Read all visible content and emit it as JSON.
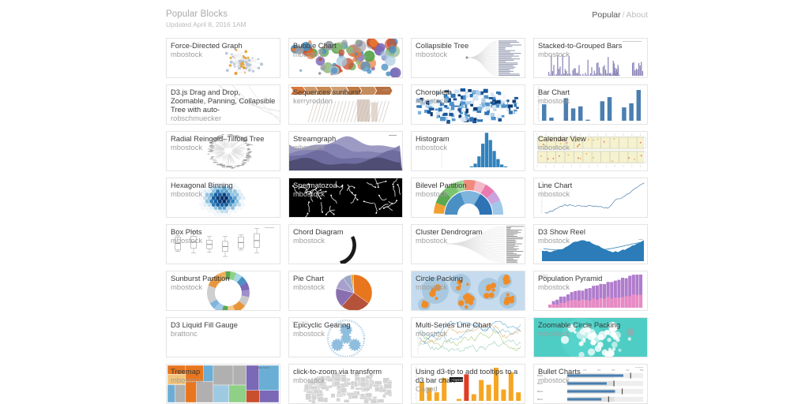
{
  "header": {
    "title": "Popular Blocks",
    "subtitle": "Updated April 8, 2016 1AM",
    "nav": {
      "current": "Popular",
      "separator": "/",
      "other": "About"
    }
  },
  "grid": {
    "cards": [
      {
        "title": "Force-Directed Graph",
        "author": "mbostock",
        "thumb": "force-directed-graph"
      },
      {
        "title": "Bubble Chart",
        "author": "mbostock",
        "thumb": "bubble-chart"
      },
      {
        "title": "Collapsible Tree",
        "author": "mbostock",
        "thumb": "collapsible-tree"
      },
      {
        "title": "Stacked-to-Grouped Bars",
        "author": "mbostock",
        "thumb": "stacked-to-grouped-bars"
      },
      {
        "title": "D3.js Drag and Drop, Zoomable, Panning, Collapsible Tree with auto-",
        "author": "robschmuecker",
        "thumb": "drag-drop-tree"
      },
      {
        "title": "Sequences sunburst",
        "author": "kerryrodden",
        "thumb": "sequences-sunburst"
      },
      {
        "title": "Choropleth",
        "author": "mbostock",
        "thumb": "choropleth"
      },
      {
        "title": "Bar Chart",
        "author": "mbostock",
        "thumb": "bar-chart"
      },
      {
        "title": "Radial Reingold–Tilford Tree",
        "author": "mbostock",
        "thumb": "radial-tidy-tree"
      },
      {
        "title": "Streamgraph",
        "author": "mbostock",
        "thumb": "streamgraph"
      },
      {
        "title": "Histogram",
        "author": "mbostock",
        "thumb": "histogram"
      },
      {
        "title": "Calendar View",
        "author": "mbostock",
        "thumb": "calendar-view"
      },
      {
        "title": "Hexagonal Binning",
        "author": "mbostock",
        "thumb": "hexagonal-binning"
      },
      {
        "title": "Spermatozoa",
        "author": "mbostock",
        "thumb": "spermatozoa"
      },
      {
        "title": "Bilevel Partition",
        "author": "mbostock",
        "thumb": "bilevel-partition"
      },
      {
        "title": "Line Chart",
        "author": "mbostock",
        "thumb": "line-chart"
      },
      {
        "title": "Box Plots",
        "author": "mbostock",
        "thumb": "box-plots"
      },
      {
        "title": "Chord Diagram",
        "author": "mbostock",
        "thumb": "chord-diagram"
      },
      {
        "title": "Cluster Dendrogram",
        "author": "mbostock",
        "thumb": "cluster-dendrogram"
      },
      {
        "title": "D3 Show Reel",
        "author": "mbostock",
        "thumb": "d3-show-reel"
      },
      {
        "title": "Sunburst Partition",
        "author": "mbostock",
        "thumb": "sunburst-partition"
      },
      {
        "title": "Pie Chart",
        "author": "mbostock",
        "thumb": "pie-chart"
      },
      {
        "title": "Circle Packing",
        "author": "mbostock",
        "thumb": "circle-packing"
      },
      {
        "title": "Population Pyramid",
        "author": "mbostock",
        "thumb": "population-pyramid"
      },
      {
        "title": "D3 Liquid Fill Gauge",
        "author": "brattonc",
        "thumb": "liquid-fill-gauge"
      },
      {
        "title": "Epicyclic Gearing",
        "author": "mbostock",
        "thumb": "epicyclic-gearing"
      },
      {
        "title": "Multi-Series Line Chart",
        "author": "mbostock",
        "thumb": "multi-series-line-chart"
      },
      {
        "title": "Zoomable Circle Packing",
        "author": "mbostock",
        "thumb": "zoomable-circle-packing"
      },
      {
        "title": "Treemap",
        "author": "mbostock",
        "thumb": "treemap"
      },
      {
        "title": "click-to-zoom via transform",
        "author": "mbostock",
        "thumb": "click-to-zoom"
      },
      {
        "title": "Using d3-tip to add tooltips to a d3 bar chart",
        "author": "Caged",
        "thumb": "d3-tip-tooltips"
      },
      {
        "title": "Bullet Charts",
        "author": "mbostock",
        "thumb": "bullet-charts"
      }
    ]
  },
  "colors": {
    "page_background": "#ffffff",
    "card_border": "#e4e4e4",
    "title_text": "#3a3a3a",
    "author_text": "#9e9e9e",
    "header_title": "#aaaaaa",
    "nav_active": "#555555",
    "teal_thumb": "#4ecdc4",
    "dark_thumb": "#000000"
  }
}
